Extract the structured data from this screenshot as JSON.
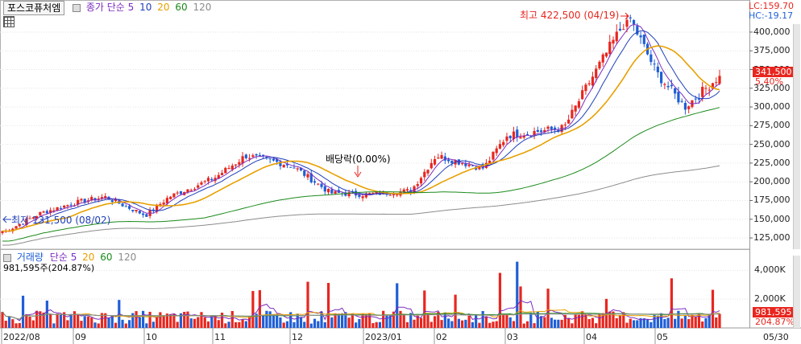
{
  "stock_name": "포스코퓨처엠",
  "price_indicators": {
    "ma_label": "종가 단순",
    "periods": [
      "5",
      "10",
      "20",
      "60",
      "120"
    ],
    "colors": [
      "#7b2cbf",
      "#1f3fb8",
      "#e8a000",
      "#1a8a1a",
      "#8c8c8c"
    ]
  },
  "volume_indicators": {
    "title": "거래량",
    "ma_label": "단순",
    "periods": [
      "5",
      "20",
      "60",
      "120"
    ],
    "colors": [
      "#7b2cbf",
      "#e8a000",
      "#1a8a1a",
      "#8c8c8c"
    ],
    "current": "981,595주(204.87%)"
  },
  "lc_label": "LC:159.70",
  "hc_label": "HC:-19.17",
  "price_axis": [
    {
      "label": "400,000",
      "value": 400000
    },
    {
      "label": "375,000",
      "value": 375000
    },
    {
      "label": "350,000",
      "value": 350000
    },
    {
      "label": "325,000",
      "value": 325000
    },
    {
      "label": "300,000",
      "value": 300000
    },
    {
      "label": "275,000",
      "value": 275000
    },
    {
      "label": "250,000",
      "value": 250000
    },
    {
      "label": "225,000",
      "value": 225000
    },
    {
      "label": "200,000",
      "value": 200000
    },
    {
      "label": "175,000",
      "value": 175000
    },
    {
      "label": "150,000",
      "value": 150000
    },
    {
      "label": "125,000",
      "value": 125000
    }
  ],
  "volume_axis": [
    {
      "label": "4,000K",
      "value": 4000000
    },
    {
      "label": "2,000K",
      "value": 2000000
    }
  ],
  "current_price": "341,500",
  "current_change": "5.40%",
  "current_volume": "981,595",
  "current_volume_pct": "204.87%",
  "annotations": {
    "high": "최고 422,500 (04/19)",
    "low": "최저 131,500 (08/02)",
    "dividend": "배당락(0.00%)"
  },
  "x_labels": [
    "2022/08",
    "09",
    "10",
    "11",
    "12",
    "2023/01",
    "02",
    "03",
    "04",
    "05"
  ],
  "end_date": "05/30",
  "colors": {
    "up": "#e8261f",
    "down": "#1f5fd6"
  },
  "chart_data": {
    "type": "candlestick",
    "series_price_anchors": [
      {
        "x": "2022/08/02",
        "close": 131500
      },
      {
        "x": "2022/08",
        "close": 158000
      },
      {
        "x": "2022/09",
        "close": 172000
      },
      {
        "x": "2022/09 mid",
        "close": 180000
      },
      {
        "x": "2022/10",
        "close": 155000
      },
      {
        "x": "2022/10 mid",
        "close": 180000
      },
      {
        "x": "2022/11",
        "close": 205000
      },
      {
        "x": "2022/11 end",
        "close": 235000
      },
      {
        "x": "2022/12",
        "close": 222000
      },
      {
        "x": "2022/12 end",
        "close": 185000
      },
      {
        "x": "2023/01",
        "close": 183000
      },
      {
        "x": "2023/01 end",
        "close": 188000
      },
      {
        "x": "2023/02",
        "close": 235000
      },
      {
        "x": "2023/02 end",
        "close": 218000
      },
      {
        "x": "2023/03",
        "close": 262000
      },
      {
        "x": "2023/03 end",
        "close": 272000
      },
      {
        "x": "2023/04",
        "close": 325000
      },
      {
        "x": "2023/04/19",
        "close": 422500
      },
      {
        "x": "2023/05",
        "close": 345000
      },
      {
        "x": "2023/05 mid",
        "close": 300000
      },
      {
        "x": "2023/05/30",
        "close": 341500
      }
    ],
    "high": {
      "value": 422500,
      "date": "04/19"
    },
    "low": {
      "value": 131500,
      "date": "08/02"
    },
    "last_close": 341500,
    "last_change_pct": 5.4,
    "last_volume": 981595,
    "ylim": [
      110000,
      430000
    ],
    "volume_ylim": [
      0,
      4800000
    ]
  }
}
